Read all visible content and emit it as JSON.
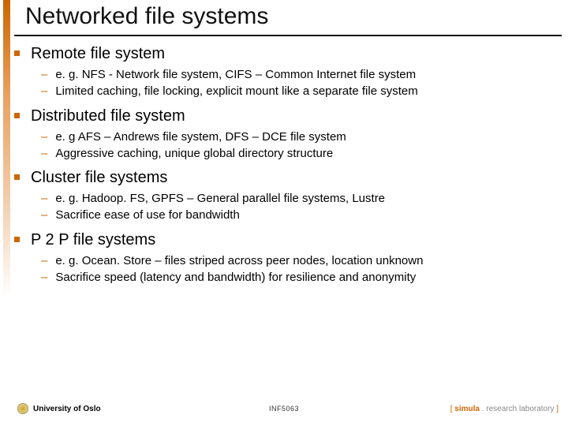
{
  "title": "Networked file systems",
  "sections": [
    {
      "heading": "Remote file system",
      "subs": [
        "e. g. NFS - Network file system, CIFS – Common Internet file system",
        "Limited caching, file locking, explicit mount like a separate file system"
      ]
    },
    {
      "heading": "Distributed file system",
      "subs": [
        "e. g AFS – Andrews file system, DFS – DCE file system",
        "Aggressive caching, unique global directory structure"
      ]
    },
    {
      "heading": "Cluster file systems",
      "subs": [
        "e. g. Hadoop. FS, GPFS – General parallel file systems, Lustre",
        "Sacrifice ease of use for bandwidth"
      ]
    },
    {
      "heading": "P 2 P file systems",
      "subs": [
        "e. g. Ocean. Store – files striped across peer nodes, location unknown",
        "Sacrifice speed (latency and bandwidth) for resilience and anonymity"
      ]
    }
  ],
  "footer": {
    "left": "University of Oslo",
    "center": "INF5063",
    "right_bracket_open": "[ ",
    "right_brand": "simula",
    "right_rest": " . research laboratory ",
    "right_bracket_close": "]"
  }
}
